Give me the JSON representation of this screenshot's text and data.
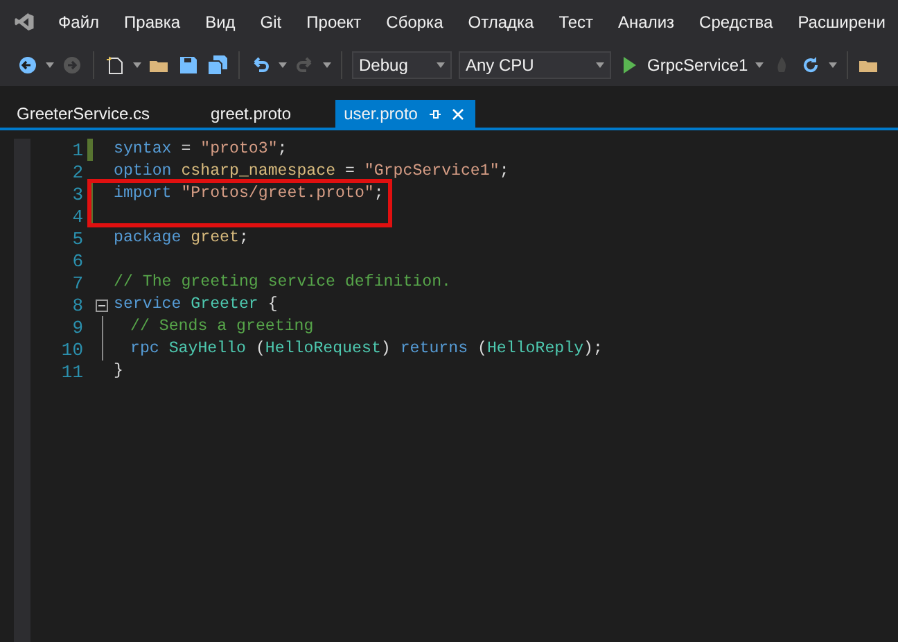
{
  "menu": {
    "items": [
      "Файл",
      "Правка",
      "Вид",
      "Git",
      "Проект",
      "Сборка",
      "Отладка",
      "Тест",
      "Анализ",
      "Средства",
      "Расширени"
    ]
  },
  "toolbar": {
    "configuration": "Debug",
    "platform": "Any CPU",
    "start_target": "GrpcService1"
  },
  "tabs": [
    {
      "label": "GreeterService.cs",
      "selected": false
    },
    {
      "label": "greet.proto",
      "selected": false
    },
    {
      "label": "user.proto",
      "selected": true
    }
  ],
  "editor": {
    "lines": [
      {
        "number": "1",
        "changed": true,
        "highlighted": false,
        "fold": false,
        "in_block": false,
        "tokens": [
          {
            "kind": "keyword",
            "text": "syntax"
          },
          {
            "kind": "plain",
            "text": " = "
          },
          {
            "kind": "string",
            "text": "\"proto3\""
          },
          {
            "kind": "plain",
            "text": ";"
          }
        ]
      },
      {
        "number": "2",
        "changed": false,
        "highlighted": false,
        "fold": false,
        "in_block": false,
        "tokens": [
          {
            "kind": "keyword",
            "text": "option"
          },
          {
            "kind": "ident",
            "text": " csharp_namespace"
          },
          {
            "kind": "plain",
            "text": " = "
          },
          {
            "kind": "string",
            "text": "\"GrpcService1\""
          },
          {
            "kind": "plain",
            "text": ";"
          }
        ]
      },
      {
        "number": "3",
        "changed": true,
        "highlighted": true,
        "fold": false,
        "in_block": false,
        "tokens": [
          {
            "kind": "keyword",
            "text": "import"
          },
          {
            "kind": "string",
            "text": " \"Protos/greet.proto\""
          },
          {
            "kind": "plain",
            "text": ";"
          }
        ]
      },
      {
        "number": "4",
        "changed": true,
        "highlighted": true,
        "fold": false,
        "in_block": false
      },
      {
        "number": "5",
        "changed": false,
        "highlighted": false,
        "fold": false,
        "in_block": false,
        "tokens": [
          {
            "kind": "keyword",
            "text": "package"
          },
          {
            "kind": "ident",
            "text": " greet"
          },
          {
            "kind": "plain",
            "text": ";"
          }
        ]
      },
      {
        "number": "6",
        "changed": false,
        "highlighted": false,
        "fold": false,
        "in_block": false
      },
      {
        "number": "7",
        "changed": false,
        "highlighted": false,
        "fold": false,
        "in_block": false,
        "tokens": [
          {
            "kind": "comment",
            "text": "// The greeting service definition."
          }
        ]
      },
      {
        "number": "8",
        "changed": false,
        "highlighted": false,
        "fold": true,
        "in_block": false,
        "tokens": [
          {
            "kind": "keyword",
            "text": "service"
          },
          {
            "kind": "type",
            "text": " Greeter"
          },
          {
            "kind": "plain",
            "text": " {"
          }
        ]
      },
      {
        "number": "9",
        "changed": false,
        "highlighted": false,
        "fold": false,
        "in_block": true,
        "tokens": [
          {
            "kind": "comment",
            "text": "// Sends a greeting"
          }
        ]
      },
      {
        "number": "10",
        "changed": false,
        "highlighted": false,
        "fold": false,
        "in_block": true,
        "tokens": [
          {
            "kind": "keyword",
            "text": "rpc"
          },
          {
            "kind": "type",
            "text": " SayHello"
          },
          {
            "kind": "plain",
            "text": " ("
          },
          {
            "kind": "type",
            "text": "HelloRequest"
          },
          {
            "kind": "plain",
            "text": ") "
          },
          {
            "kind": "keyword",
            "text": "returns"
          },
          {
            "kind": "plain",
            "text": " ("
          },
          {
            "kind": "type",
            "text": "HelloReply"
          },
          {
            "kind": "plain",
            "text": ");"
          }
        ]
      },
      {
        "number": "11",
        "changed": false,
        "highlighted": false,
        "fold": false,
        "in_block": false,
        "tokens": [
          {
            "kind": "plain",
            "text": "}"
          }
        ]
      }
    ]
  }
}
